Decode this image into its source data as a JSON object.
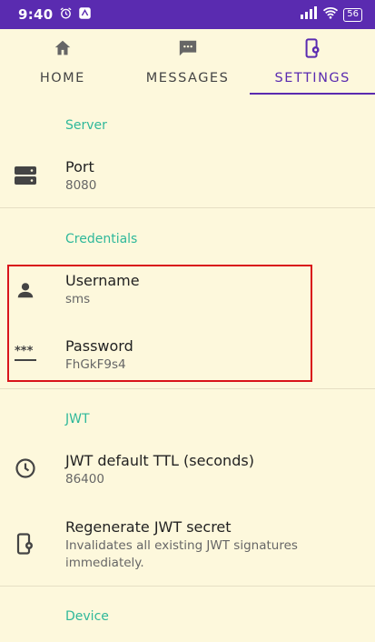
{
  "status_bar": {
    "time": "9:40",
    "battery": "56"
  },
  "tabs": [
    {
      "label": "HOME",
      "icon": "home-icon",
      "active": false
    },
    {
      "label": "MESSAGES",
      "icon": "message-icon",
      "active": false
    },
    {
      "label": "SETTINGS",
      "icon": "settings-phone-icon",
      "active": true
    }
  ],
  "sections": {
    "server": {
      "header": "Server",
      "port": {
        "title": "Port",
        "value": "8080",
        "icon": "server-icon"
      }
    },
    "credentials": {
      "header": "Credentials",
      "username": {
        "title": "Username",
        "value": "sms",
        "icon": "person-icon"
      },
      "password": {
        "title": "Password",
        "value": "FhGkF9s4",
        "icon": "password-icon"
      }
    },
    "jwt": {
      "header": "JWT",
      "ttl": {
        "title": "JWT default TTL (seconds)",
        "value": "86400",
        "icon": "clock-icon"
      },
      "regenerate": {
        "title": "Regenerate JWT secret",
        "value": "Invalidates all existing JWT signatures immediately.",
        "icon": "phone-settings-icon"
      }
    },
    "device": {
      "header": "Device"
    }
  },
  "colors": {
    "accent": "#5a2bb0",
    "section_header": "#2fb89a",
    "background": "#fdf8dc",
    "highlight": "#d9141b"
  }
}
